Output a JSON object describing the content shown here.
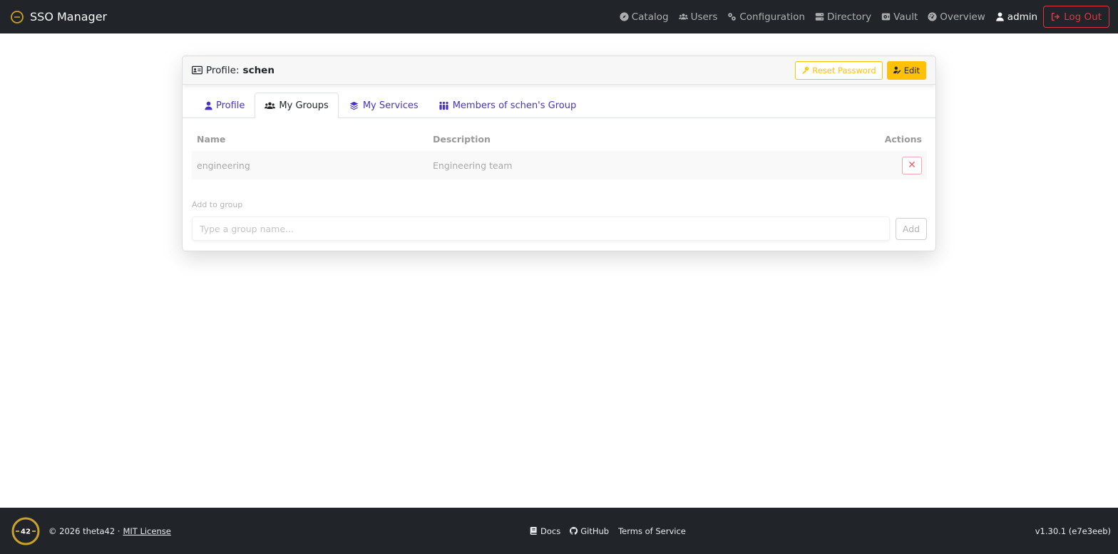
{
  "app": {
    "title": "SSO Manager"
  },
  "nav": {
    "items": [
      {
        "label": "Catalog",
        "icon": "compass-icon"
      },
      {
        "label": "Users",
        "icon": "users-icon"
      },
      {
        "label": "Configuration",
        "icon": "gears-icon"
      },
      {
        "label": "Directory",
        "icon": "server-icon"
      },
      {
        "label": "Vault",
        "icon": "vault-icon"
      },
      {
        "label": "Overview",
        "icon": "dashboard-icon"
      }
    ],
    "user": "admin",
    "logout_label": "Log Out"
  },
  "card": {
    "title_prefix": "Profile:",
    "username": "schen",
    "reset_password_label": "Reset Password",
    "edit_label": "Edit"
  },
  "tabs": [
    {
      "label": "Profile",
      "active": false
    },
    {
      "label": "My Groups",
      "active": true
    },
    {
      "label": "My Services",
      "active": false
    },
    {
      "label": "Members of schen's Group",
      "active": false
    }
  ],
  "groups_table": {
    "headers": {
      "name": "Name",
      "description": "Description",
      "actions": "Actions"
    },
    "rows": [
      {
        "name": "engineering",
        "description": "Engineering team",
        "remove_symbol": "✕"
      }
    ]
  },
  "add_group": {
    "label": "Add to group",
    "placeholder": "Type a group name...",
    "value": "",
    "button_label": "Add"
  },
  "footer": {
    "logo_text": "42",
    "copyright": "© 2026 theta42 ·",
    "license_label": "MIT License",
    "links": [
      {
        "label": "Docs",
        "icon": "book-icon"
      },
      {
        "label": "GitHub",
        "icon": "github-icon"
      },
      {
        "label": "Terms of Service",
        "icon": ""
      }
    ],
    "version": "v1.30.1 (e7e3eeb)"
  },
  "colors": {
    "navbar_bg": "#212529",
    "accent_link": "#4733c8",
    "warning": "#ffc107",
    "danger": "#dc3545",
    "brand_gold": "#c9a227"
  }
}
